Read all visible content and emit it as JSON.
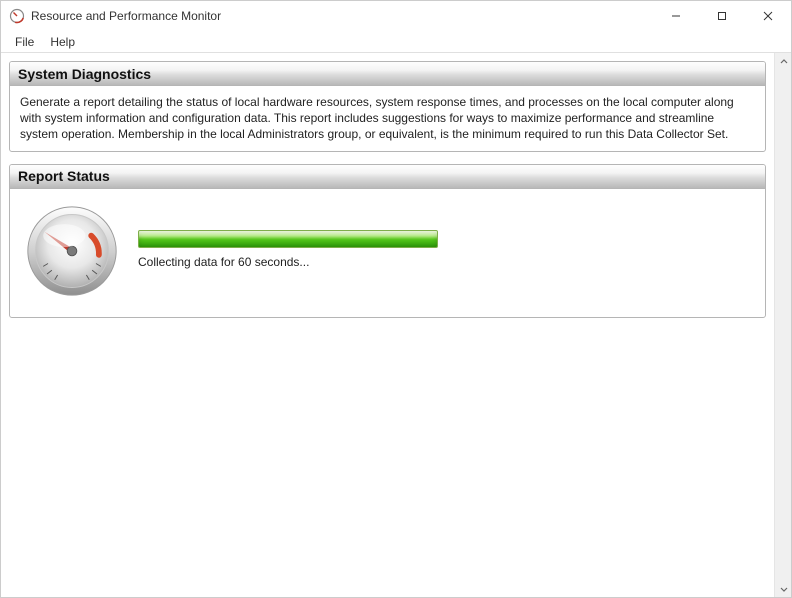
{
  "window": {
    "title": "Resource and Performance Monitor"
  },
  "menu": {
    "file": "File",
    "help": "Help"
  },
  "panels": {
    "diagnostics": {
      "title": "System Diagnostics",
      "description": "Generate a report detailing the status of local hardware resources, system response times, and processes on the local computer along with system information and configuration data. This report includes suggestions for ways to maximize performance and streamline system operation. Membership in the local Administrators group, or equivalent, is the minimum required to run this Data Collector Set."
    },
    "reportStatus": {
      "title": "Report Status",
      "statusText": "Collecting data for 60 seconds..."
    }
  }
}
